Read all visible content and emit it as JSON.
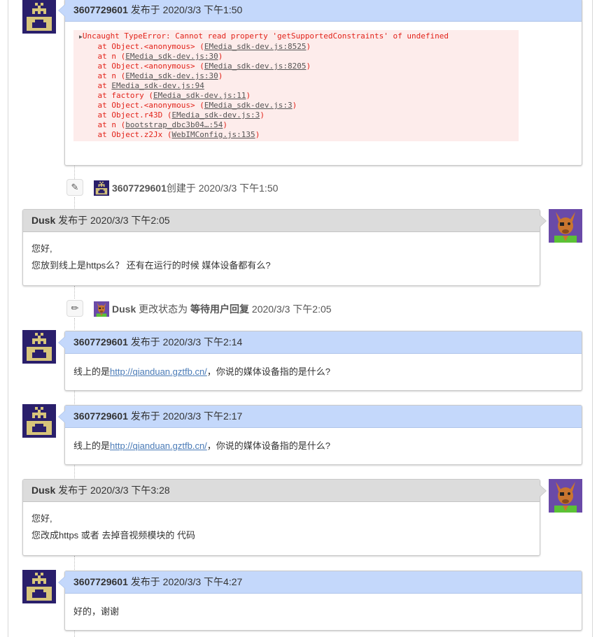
{
  "posts": [
    {
      "user": "3607729601",
      "meta": "发布于 2020/3/3 下午1:50"
    },
    {
      "user": "Dusk",
      "meta": "发布于 2020/3/3 下午2:05",
      "lines": [
        "您好,",
        "您放到线上是https么？ 还有在运行的时候 媒体设备都有么?"
      ]
    },
    {
      "user": "3607729601",
      "meta": "发布于 2020/3/3 下午2:14",
      "pre": "线上的是",
      "link": "http://qianduan.gztfb.cn/",
      "post": "，你说的媒体设备指的是什么?"
    },
    {
      "user": "3607729601",
      "meta": "发布于 2020/3/3 下午2:17",
      "pre": "线上的是",
      "link": "http://qianduan.gztfb.cn/",
      "post": "，你说的媒体设备指的是什么?"
    },
    {
      "user": "Dusk",
      "meta": "发布于 2020/3/3 下午3:28",
      "lines": [
        "您好,",
        "您改成https 或者 去掉音视频模块的 代码"
      ]
    },
    {
      "user": "3607729601",
      "meta": "发布于 2020/3/3 下午4:27",
      "lines": [
        "好的，谢谢"
      ]
    }
  ],
  "error": {
    "head": "Uncaught TypeError: Cannot read property 'getSupportedConstraints' of undefined",
    "lines": [
      {
        "p": "at Object.<anonymous> (",
        "f": "EMedia_sdk-dev.js:8525",
        "s": ")"
      },
      {
        "p": "at n (",
        "f": "EMedia_sdk-dev.js:30",
        "s": ")"
      },
      {
        "p": "at Object.<anonymous> (",
        "f": "EMedia_sdk-dev.js:8205",
        "s": ")"
      },
      {
        "p": "at n (",
        "f": "EMedia_sdk-dev.js:30",
        "s": ")"
      },
      {
        "p": "at ",
        "f": "EMedia_sdk-dev.js:94",
        "s": ""
      },
      {
        "p": "at factory (",
        "f": "EMedia_sdk-dev.js:11",
        "s": ")"
      },
      {
        "p": "at Object.<anonymous> (",
        "f": "EMedia_sdk-dev.js:3",
        "s": ")"
      },
      {
        "p": "at Object.r43D (",
        "f": "EMedia_sdk-dev.js:3",
        "s": ")"
      },
      {
        "p": "at n (",
        "f": "bootstrap_dbc3b04…:54",
        "s": ")"
      },
      {
        "p": "at Object.z2Jx (",
        "f": "WebIMConfig.js:135",
        "s": ")"
      }
    ]
  },
  "events": [
    {
      "user": "3607729601",
      "text": "创建于 2020/3/3 下午1:50",
      "icon": "magic-wand-icon"
    },
    {
      "user": "Dusk",
      "text1": " 更改状态为 ",
      "status": "等待用户回复",
      "text2": " 2020/3/3 下午2:05",
      "icon": "pencil-icon"
    }
  ],
  "colors": {
    "user_header": "#c4d8fb",
    "agent_header": "#dcdcdc",
    "error_text": "#e2231a",
    "error_bg": "#fdeceb",
    "link": "#4a7bb7"
  }
}
